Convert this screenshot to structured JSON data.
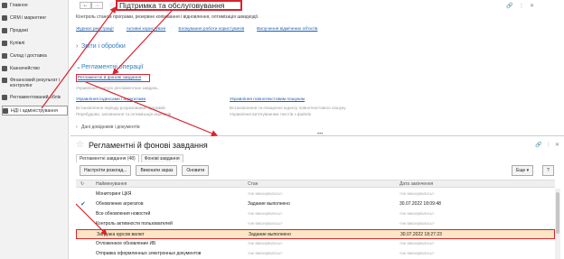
{
  "sidebar": {
    "items": [
      {
        "label": "Главное"
      },
      {
        "label": "CRM і маркетинг"
      },
      {
        "label": "Продажі"
      },
      {
        "label": "Купівлі"
      },
      {
        "label": "Склад і доставка"
      },
      {
        "label": "Казначейство"
      },
      {
        "label": "Фінансовий результат і контролінг"
      },
      {
        "label": "Регламентований облік"
      },
      {
        "label": "НДІ і адміністрування"
      }
    ]
  },
  "header": {
    "back": "←",
    "forward": "→",
    "title": "Підтримка та обслуговування",
    "subtitle": "Контроль станом програми, резервне копіювання і відновлення, оптимізація швидкодії."
  },
  "links": [
    "Журнал реєстрації",
    "Активні користувачі",
    "Блокування роботи користувачів",
    "Вилучення відмічених об'єктів"
  ],
  "sections": {
    "reports": "Звіти і обробки",
    "reglament": "Регламентні операції",
    "bottom": "Дані довідників і документів"
  },
  "reglament": {
    "link": "Регламентні й фонові завдання",
    "link_desc": "Управління і запуск регламентних завдань.",
    "block1_title": "Управління індексами і агрегатами",
    "block1_desc_1": "Встановлення періоду розрахованих підсумків",
    "block1_desc_2": "Перебудова, заповнення та оптимізація агрегатів",
    "block2_title": "Управління повнотекстовим пошуком",
    "block2_desc_1": "Встановлення та очищення індексу повнотекстового пошуку.",
    "block2_desc_2": "Управління витягуванням текстів з файлів"
  },
  "subwindow": {
    "title": "Регламентні й фонові завдання",
    "tabs": [
      "Регламентні завдання (48)",
      "Фонові завдання"
    ],
    "buttons": {
      "configure": "Настроїти розклад...",
      "run": "Виконати зараз",
      "refresh": "Оновити",
      "more": "Еще",
      "help": "?"
    },
    "columns": {
      "name": "Найменування",
      "state": "Стан",
      "date": "Дата закінчення"
    },
    "rows": [
      {
        "name": "Мониторинг ЦКЯ",
        "state": "<не виконувалось>",
        "date": "<не виконувалось>",
        "checked": false
      },
      {
        "name": "Обновление агрегатов",
        "state": "Задание выполнено",
        "date": "30.07.2022 18:09:48",
        "checked": true
      },
      {
        "name": "Все обновления новостей",
        "state": "<не виконувалось>",
        "date": "<не виконувалось>",
        "checked": false
      },
      {
        "name": "Контроль активности пользователей",
        "state": "<не виконувалось>",
        "date": "<не виконувалось>",
        "checked": false
      },
      {
        "name": "Загрузка курсов валют",
        "state": "Задание выполнено",
        "date": "30.07.2022 18:27:23",
        "checked": false
      },
      {
        "name": "Отложенное обновление ИБ",
        "state": "<не виконувалось>",
        "date": "<не виконувалось>",
        "checked": false
      },
      {
        "name": "Отправка оформленных электронных документов",
        "state": "<не виконувалось>",
        "date": "<не виконувалось>",
        "checked": false
      }
    ]
  },
  "colors": {
    "accent_red": "#d9232e",
    "link_blue": "#1a5fb4",
    "section_blue": "#2f7ec2",
    "selected_row": "#fbe7c5"
  }
}
